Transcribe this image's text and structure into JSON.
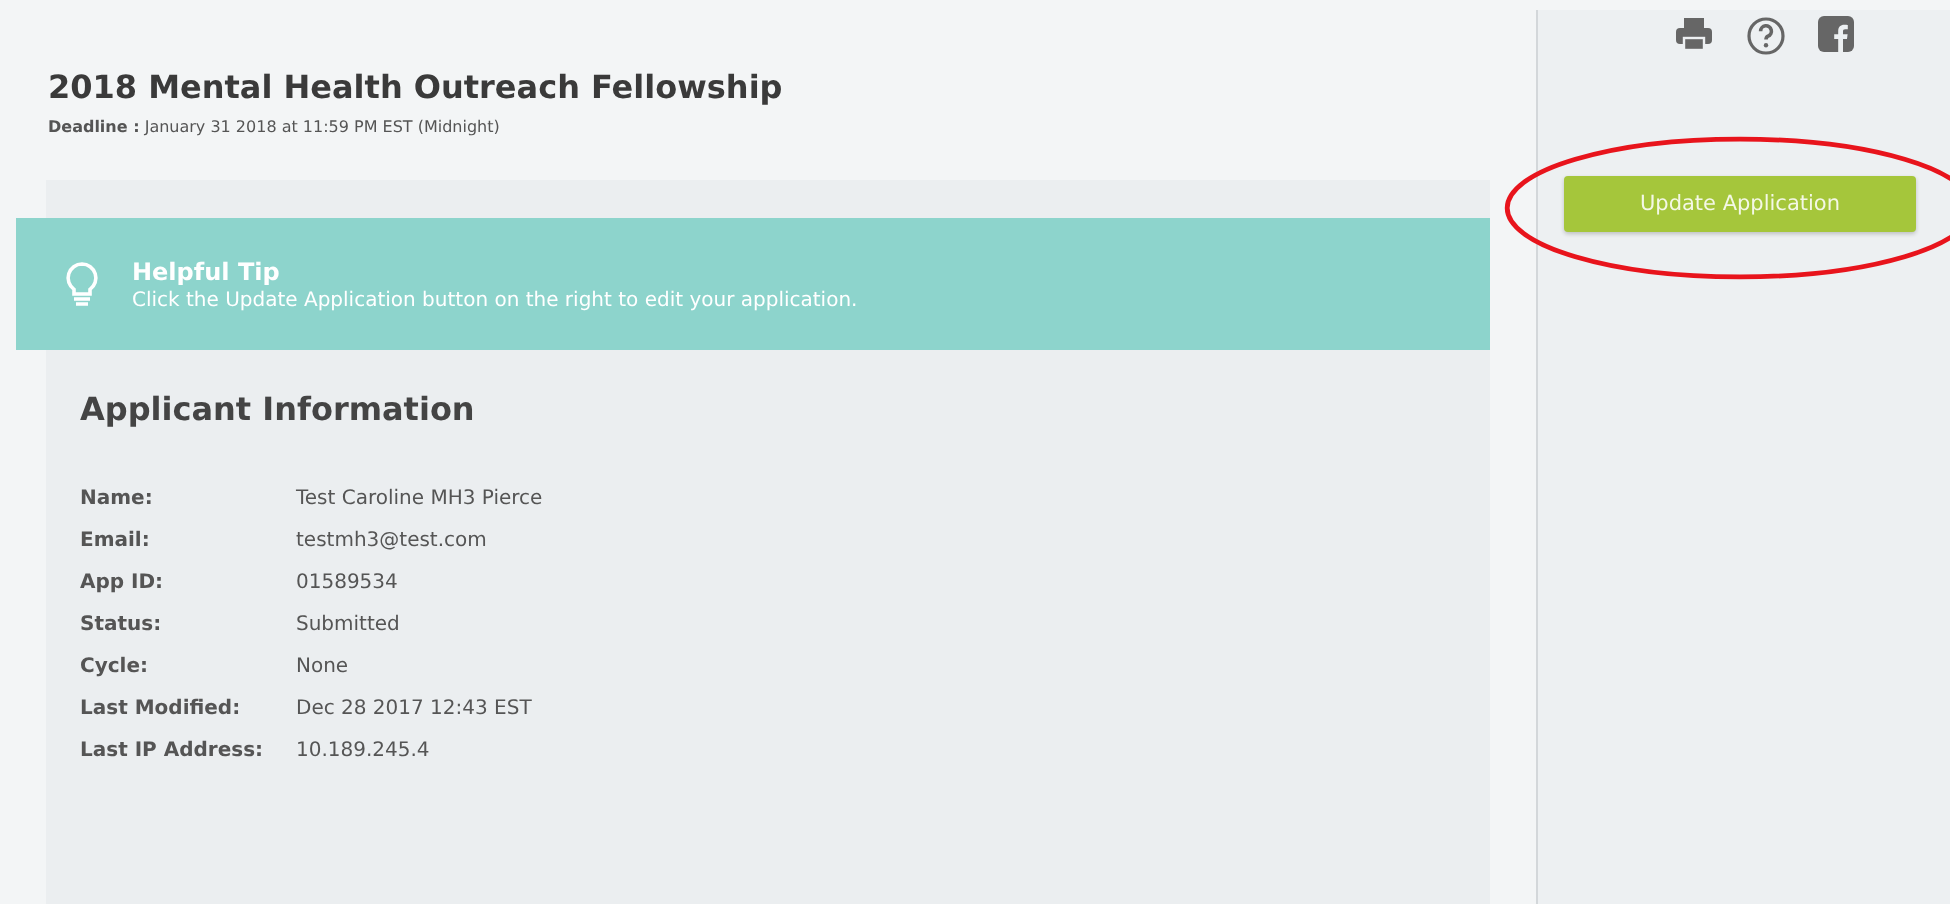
{
  "header": {
    "title": "2018 Mental Health Outreach Fellowship",
    "deadline_label": "Deadline :",
    "deadline_value": "January 31 2018 at 11:59 PM EST (Midnight)"
  },
  "tip": {
    "title": "Helpful Tip",
    "text": "Click the Update Application button on the right to edit your application."
  },
  "applicant": {
    "heading": "Applicant Information",
    "fields": [
      {
        "label": "Name:",
        "value": "Test Caroline MH3 Pierce"
      },
      {
        "label": "Email:",
        "value": "testmh3@test.com"
      },
      {
        "label": "App ID:",
        "value": "01589534"
      },
      {
        "label": "Status:",
        "value": "Submitted"
      },
      {
        "label": "Cycle:",
        "value": "None"
      },
      {
        "label": "Last Modified:",
        "value": "Dec 28 2017 12:43 EST"
      },
      {
        "label": "Last IP Address:",
        "value": "10.189.245.4"
      }
    ]
  },
  "sidebar": {
    "icons": [
      {
        "kind": "print"
      },
      {
        "kind": "help"
      },
      {
        "kind": "facebook"
      }
    ],
    "button": "Update Application",
    "highlighted": true
  }
}
